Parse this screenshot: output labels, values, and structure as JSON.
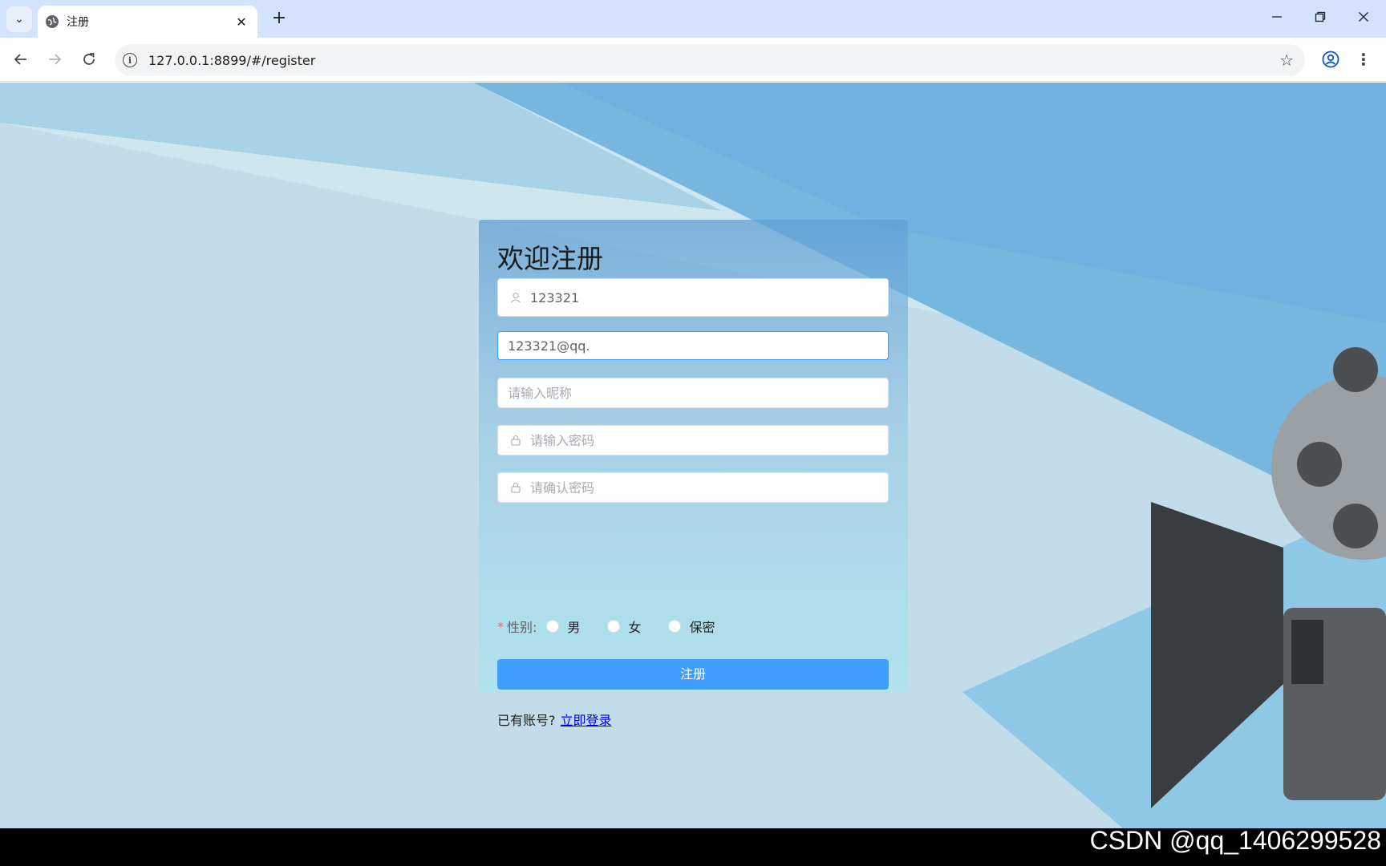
{
  "browser": {
    "tab_title": "注册",
    "url": "127.0.0.1:8899/#/register",
    "new_tab_label": "+",
    "close_tab_label": "✕"
  },
  "register": {
    "heading": "欢迎注册",
    "username_value": "123321",
    "email_value": "123321@qq.",
    "nickname_placeholder": "请输入昵称",
    "password_placeholder": "请输入密码",
    "confirm_placeholder": "请确认密码",
    "gender_required_mark": "*",
    "gender_label": "性别:",
    "gender_options": [
      "男",
      "女",
      "保密"
    ],
    "submit_label": "注册",
    "have_account_text": "已有账号?",
    "login_link": "立即登录"
  },
  "watermark": "CSDN @qq_1406299528",
  "colors": {
    "primary": "#409eff",
    "tabstrip": "#d3e3fd",
    "required": "#f56c6c"
  }
}
